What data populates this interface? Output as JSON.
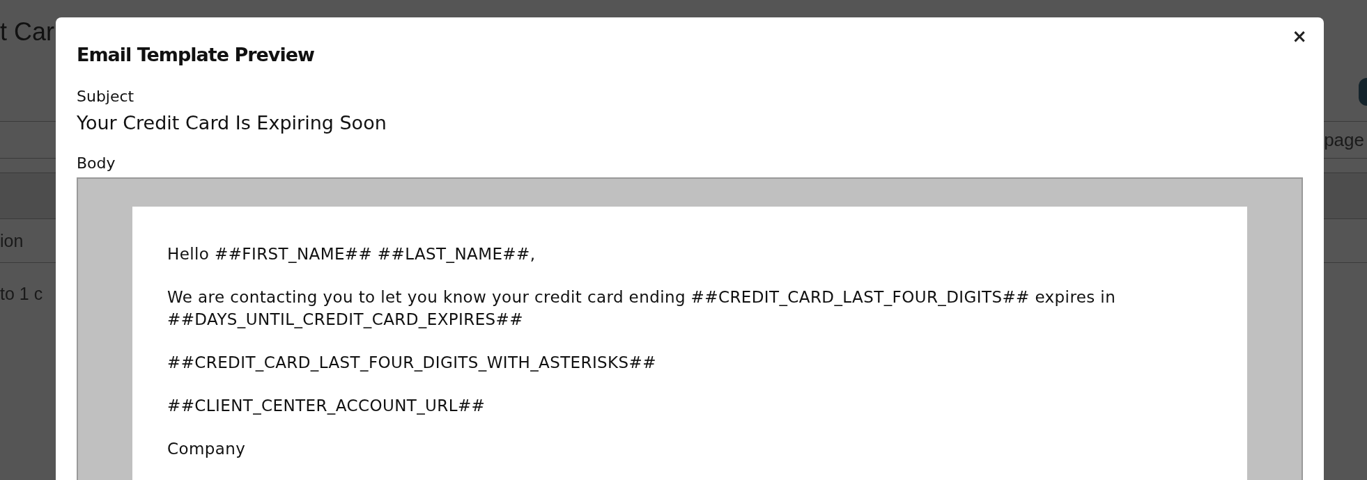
{
  "background": {
    "page_title": "t Car",
    "toolbar_text": "page",
    "table_header": "ion",
    "table_info": "to 1 c"
  },
  "modal": {
    "title": "Email Template Preview",
    "close": "×",
    "subject_label": "Subject",
    "subject": "Your Credit Card Is Expiring Soon",
    "body_label": "Body",
    "body_paragraphs": [
      "Hello ##FIRST_NAME## ##LAST_NAME##,",
      "We are contacting you to let you know your credit card ending ##CREDIT_CARD_LAST_FOUR_DIGITS## expires in ##DAYS_UNTIL_CREDIT_CARD_EXPIRES##",
      "##CREDIT_CARD_LAST_FOUR_DIGITS_WITH_ASTERISKS##",
      "##CLIENT_CENTER_ACCOUNT_URL##",
      "Company"
    ]
  }
}
